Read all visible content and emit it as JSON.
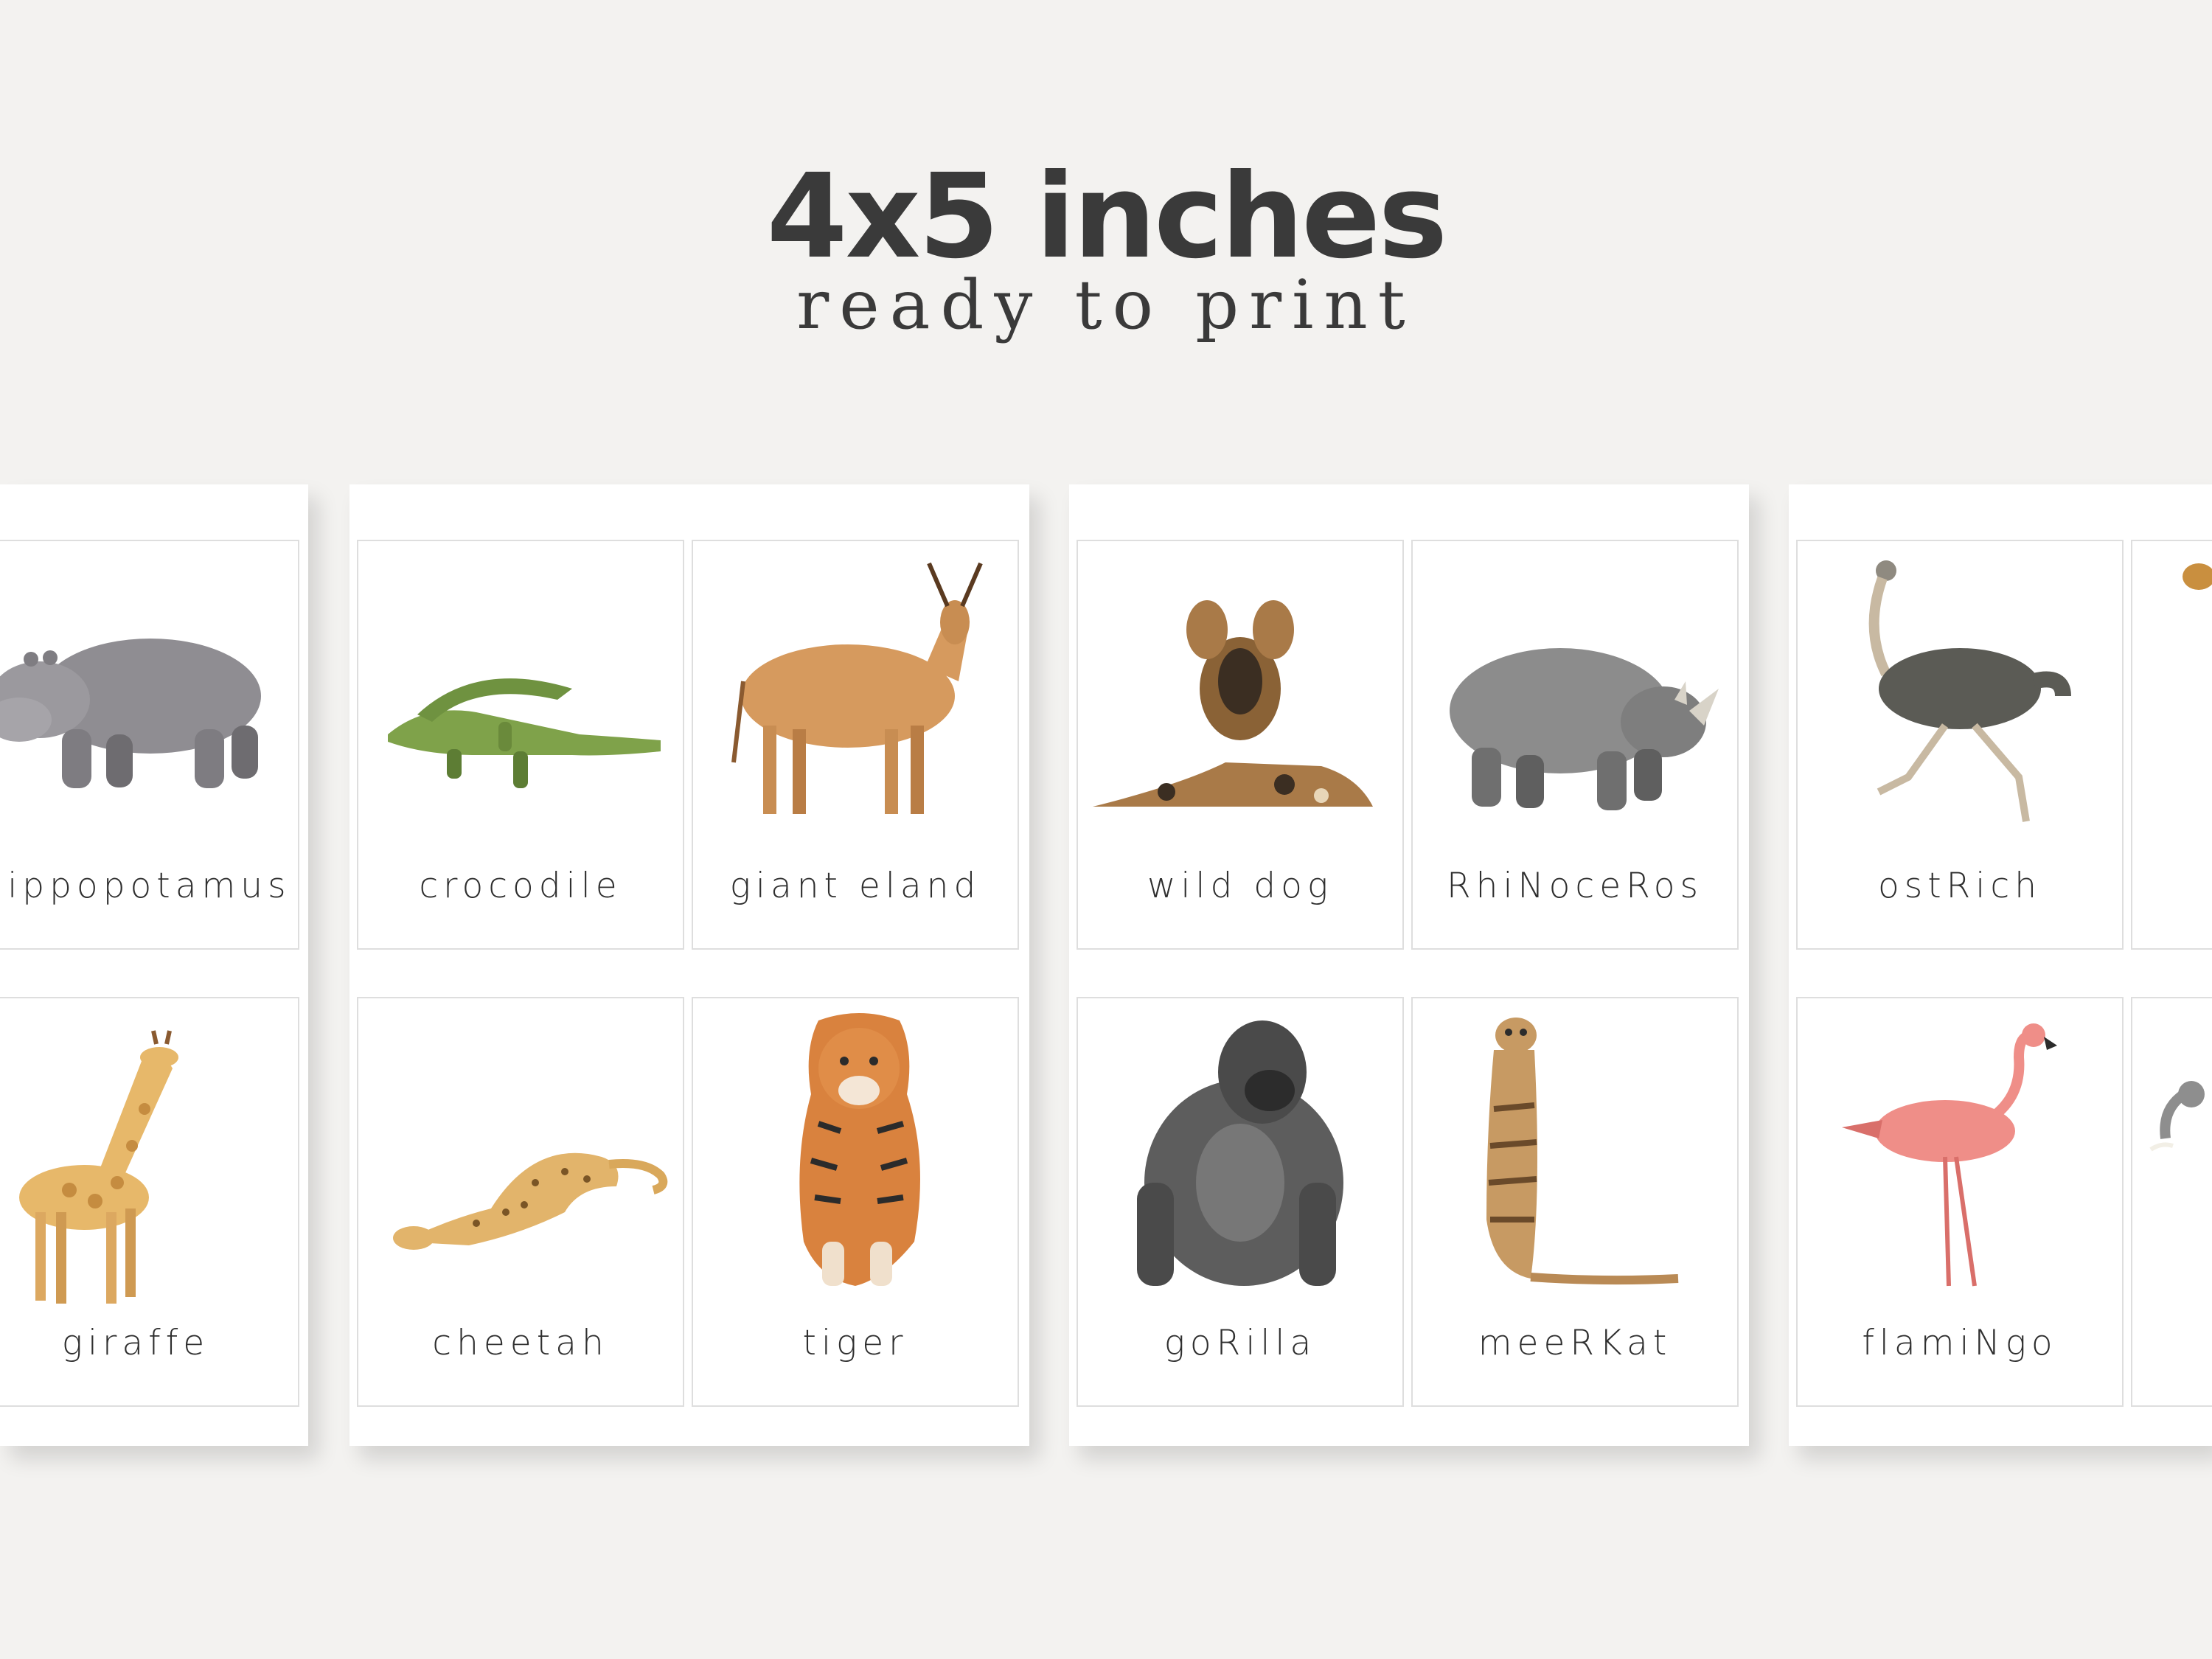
{
  "header": {
    "title": "4x5 inches",
    "subtitle": "ready to print"
  },
  "sheets": [
    {
      "cards": [
        {
          "label": "hippopotamus",
          "icon": "hippopotamus-illustration",
          "colors": [
            "#8f8d92",
            "#6e6c70"
          ]
        },
        {
          "label": "giraffe",
          "icon": "giraffe-illustration",
          "colors": [
            "#e7b86a",
            "#b07a36"
          ]
        }
      ]
    },
    {
      "cards": [
        {
          "label": "crocodile",
          "icon": "crocodile-illustration",
          "colors": [
            "#7fa24a",
            "#5d7d34"
          ]
        },
        {
          "label": "giant eland",
          "icon": "giant-eland-illustration",
          "colors": [
            "#d69a5e",
            "#8a5a30"
          ]
        },
        {
          "label": "cheetah",
          "icon": "cheetah-illustration",
          "colors": [
            "#e2b46b",
            "#7a5526"
          ]
        },
        {
          "label": "tiger",
          "icon": "tiger-illustration",
          "colors": [
            "#d9823e",
            "#2b2b2b"
          ]
        }
      ]
    },
    {
      "cards": [
        {
          "label": "wild dog",
          "icon": "wild-dog-illustration",
          "colors": [
            "#a97a48",
            "#3b2e22"
          ]
        },
        {
          "label": "RhiNoceRos",
          "icon": "rhinoceros-illustration",
          "colors": [
            "#8c8c8c",
            "#5f5f5f"
          ]
        },
        {
          "label": "goRilla",
          "icon": "gorilla-illustration",
          "colors": [
            "#5d5d5d",
            "#2c2c2c"
          ]
        },
        {
          "label": "meeRKat",
          "icon": "meerkat-illustration",
          "colors": [
            "#c79a63",
            "#6a4a2a"
          ]
        }
      ]
    },
    {
      "cards": [
        {
          "label": "ostRich",
          "icon": "ostrich-illustration",
          "colors": [
            "#5b5b55",
            "#c8b9a2"
          ]
        },
        {
          "label": "",
          "icon": "partial-animal-illustration",
          "colors": [
            "#c98f3f",
            "#8a6a3a"
          ]
        },
        {
          "label": "flamiNgo",
          "icon": "flamingo-illustration",
          "colors": [
            "#ef8e88",
            "#d96f6a"
          ]
        },
        {
          "label": "",
          "icon": "elephant-illustration",
          "colors": [
            "#8e8e8e",
            "#f2efe6"
          ]
        }
      ]
    }
  ]
}
